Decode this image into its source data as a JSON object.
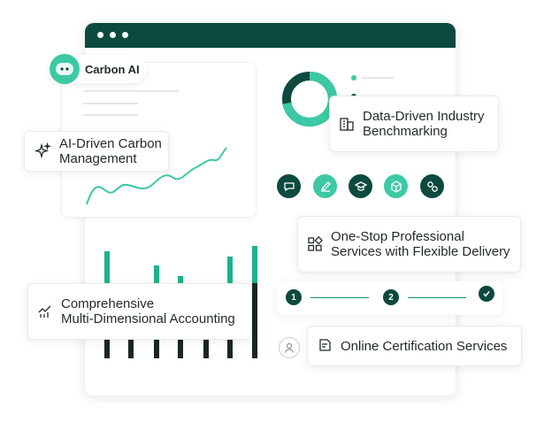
{
  "brand": {
    "name": "Carbon AI"
  },
  "features": {
    "ai_management_line1": "AI-Driven Carbon",
    "ai_management_line2": "Management",
    "benchmarking_line1": "Data-Driven Industry",
    "benchmarking_line2": "Benchmarking",
    "services_line1": "One-Stop Professional",
    "services_line2": "Services with Flexible Delivery",
    "accounting_line1": "Comprehensive",
    "accounting_line2": "Multi-Dimensional Accounting",
    "certification": "Online Certification Services"
  },
  "stepper": {
    "step1": "1",
    "step2": "2"
  },
  "donut": {
    "primary_fraction": 0.72
  },
  "colors": {
    "dark_green": "#0c4a3e",
    "accent_green": "#3cc9a3",
    "teal": "#1fb28b"
  },
  "tool_icons": [
    "chat-icon",
    "edit-icon",
    "graduation-cap-icon",
    "cube-icon",
    "link-icon"
  ]
}
